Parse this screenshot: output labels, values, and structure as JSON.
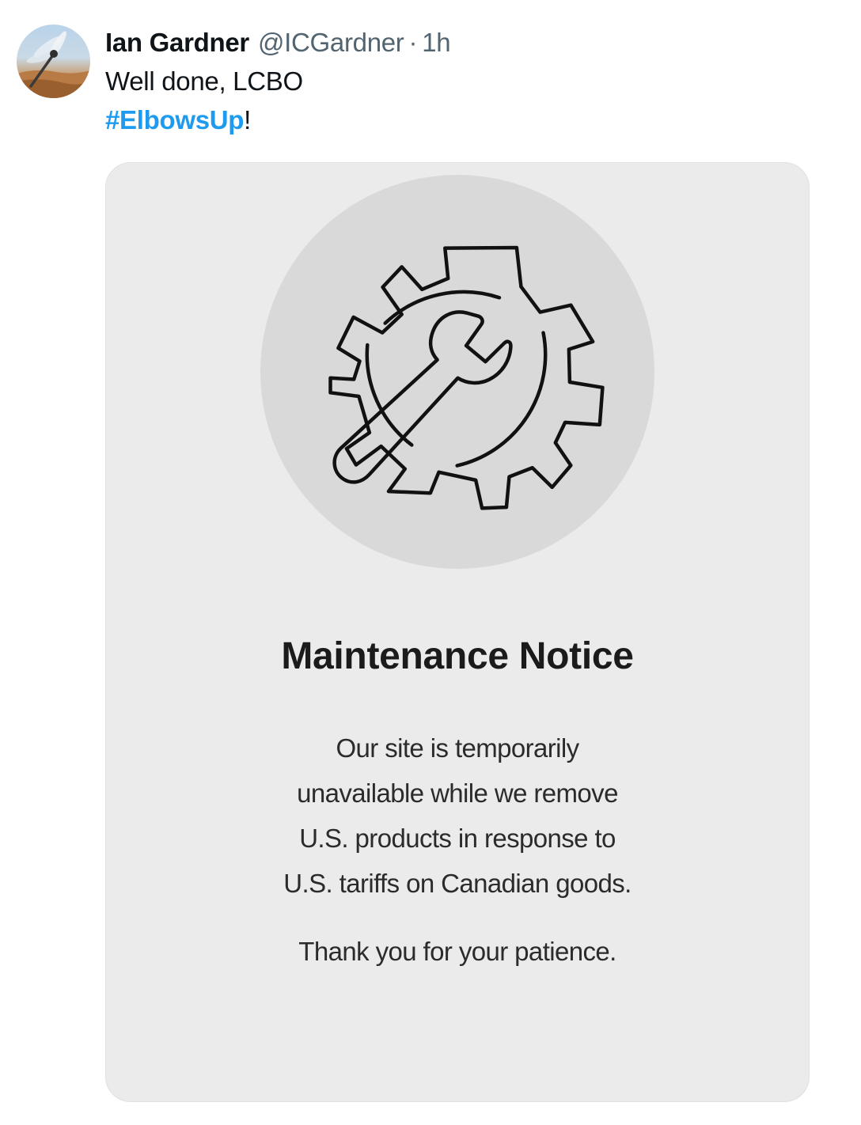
{
  "post": {
    "author_name": "Ian Gardner",
    "author_handle": "@ICGardner",
    "separator": "·",
    "time": "1h",
    "text_line1": "Well done, LCBO",
    "hashtag": "#ElbowsUp",
    "hashtag_suffix": "!"
  },
  "card": {
    "icon": "gear-wrench-icon",
    "title": "Maintenance Notice",
    "body_lines": [
      "Our site is temporarily",
      "unavailable while we remove",
      "U.S. products in response to",
      "U.S. tariffs on Canadian goods."
    ],
    "closing": "Thank you for your patience."
  },
  "colors": {
    "hashtag": "#1d9bf0",
    "card_background": "#ebebeb",
    "icon_circle": "#d9d9d9"
  }
}
